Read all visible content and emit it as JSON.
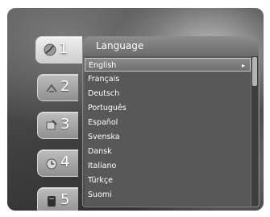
{
  "menu": {
    "title": "Language",
    "tabs": [
      {
        "num": "1",
        "icon": "satellite-dish-icon",
        "active": true
      },
      {
        "num": "2",
        "icon": "antenna-icon",
        "active": false
      },
      {
        "num": "3",
        "icon": "tools-icon",
        "active": false
      },
      {
        "num": "4",
        "icon": "clock-icon",
        "active": false
      },
      {
        "num": "5",
        "icon": "storage-icon",
        "active": false
      }
    ],
    "languages": [
      "English",
      "Français",
      "Deutsch",
      "Português",
      "Español",
      "Svenska",
      "Dansk",
      "Italiano",
      "Türkçe",
      "Suomi"
    ],
    "selected_index": 0,
    "submenu_arrow": "▸"
  },
  "colors": {
    "panel": "#585858",
    "header": "#7a7a7a",
    "text": "#ffffff"
  }
}
